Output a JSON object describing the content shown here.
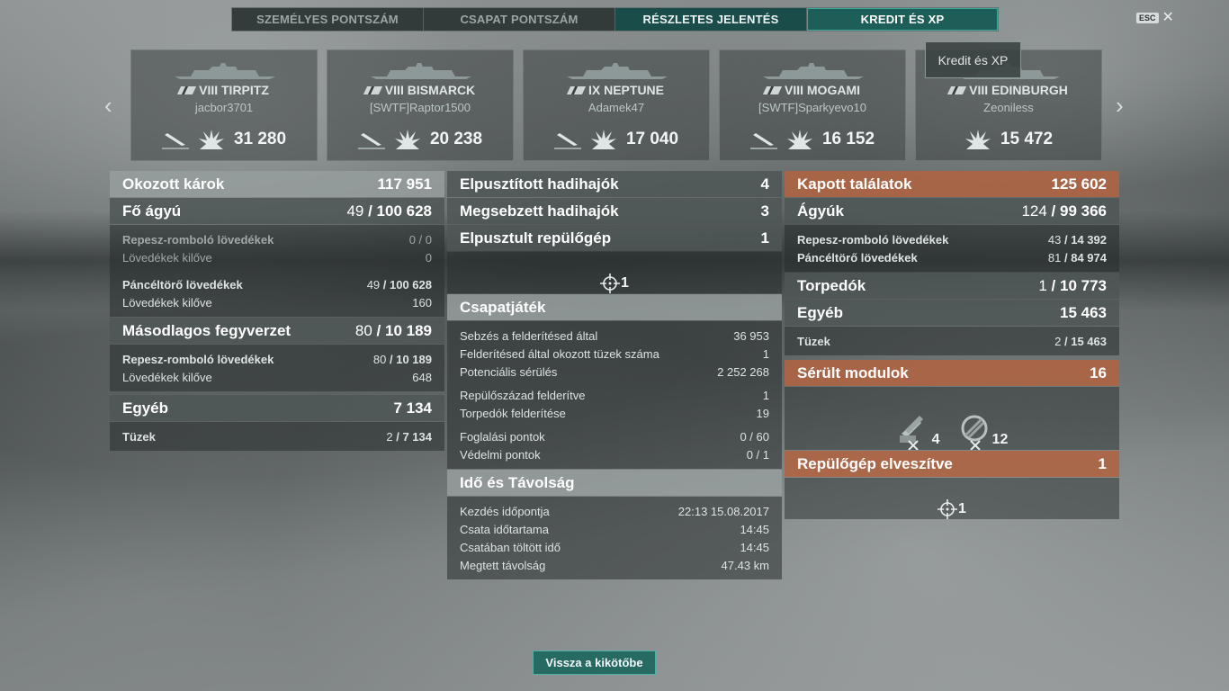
{
  "tabs": [
    {
      "label": "SZEMÉLYES PONTSZÁM"
    },
    {
      "label": "CSAPAT PONTSZÁM"
    },
    {
      "label": "RÉSZLETES JELENTÉS"
    },
    {
      "label": "KREDIT ÉS XP"
    }
  ],
  "esc": {
    "key": "ESC",
    "close": "✕"
  },
  "tooltip": "Kredit és XP",
  "ships": [
    {
      "name": "VIII TIRPITZ",
      "player": "jacbor3701",
      "damage": "31 280"
    },
    {
      "name": "VIII BISMARCK",
      "player": "[SWTF]Raptor1500",
      "damage": "20 238"
    },
    {
      "name": "IX NEPTUNE",
      "player": "Adamek47",
      "damage": "17 040"
    },
    {
      "name": "VIII MOGAMI",
      "player": "[SWTF]Sparkyevo10",
      "damage": "16 152"
    },
    {
      "name": "VIII EDINBURGH",
      "player": "Zeoniless",
      "damage": "15 472"
    }
  ],
  "left": {
    "caused_damage": {
      "label": "Okozott károk",
      "value": "117 951"
    },
    "main_gun": {
      "label": "Fő ágyú",
      "hits": "49",
      "total": "100 628"
    },
    "he_shells": {
      "label": "Repesz-romboló lövedékek",
      "value": "0 / 0"
    },
    "he_fired": {
      "label": "Lövedékek kilőve",
      "value": "0"
    },
    "ap_shells": {
      "label": "Páncéltörő lövedékek",
      "hits": "49",
      "total": "100 628"
    },
    "ap_fired": {
      "label": "Lövedékek kilőve",
      "value": "160"
    },
    "secondary": {
      "label": "Másodlagos fegyverzet",
      "hits": "80",
      "total": "10 189"
    },
    "sec_he": {
      "label": "Repesz-romboló lövedékek",
      "hits": "80",
      "total": "10 189"
    },
    "sec_fired": {
      "label": "Lövedékek kilőve",
      "value": "648"
    },
    "other": {
      "label": "Egyéb",
      "value": "7 134"
    },
    "fires": {
      "label": "Tüzek",
      "hits": "2",
      "total": "7 134"
    }
  },
  "middle": {
    "destroyed_ships": {
      "label": "Elpusztított hadihajók",
      "value": "4"
    },
    "damaged_ships": {
      "label": "Megsebzett hadihajók",
      "value": "3"
    },
    "destroyed_planes": {
      "label": "Elpusztult repülőgép",
      "value": "1"
    },
    "planes_count": "1",
    "teamplay": {
      "title": "Csapatjáték",
      "rows": [
        {
          "label": "Sebzés a felderítésed által",
          "value": "36 953"
        },
        {
          "label": "Felderítésed által okozott tüzek száma",
          "value": "1"
        },
        {
          "label": "Potenciális sérülés",
          "value": "2 252 268"
        },
        {
          "label": "Repülőszázad felderítve",
          "value": "1"
        },
        {
          "label": "Torpedók felderítése",
          "value": "19"
        },
        {
          "label": "Foglalási pontok",
          "value": "0 / 60"
        },
        {
          "label": "Védelmi pontok",
          "value": "0 / 1"
        }
      ]
    },
    "time": {
      "title": "Idő és Távolság",
      "rows": [
        {
          "label": "Kezdés időpontja",
          "value": "22:13  15.08.2017"
        },
        {
          "label": "Csata időtartama",
          "value": "14:45"
        },
        {
          "label": "Csatában töltött idő",
          "value": "14:45"
        },
        {
          "label": "Megtett távolság",
          "value": "47.43 km"
        }
      ]
    }
  },
  "right": {
    "received": {
      "label": "Kapott találatok",
      "value": "125 602"
    },
    "guns": {
      "label": "Ágyúk",
      "hits": "124",
      "total": "99 366"
    },
    "he": {
      "label": "Repesz-romboló lövedékek",
      "hits": "43",
      "total": "14 392"
    },
    "ap": {
      "label": "Páncéltörő lövedékek",
      "hits": "81",
      "total": "84 974"
    },
    "torpedoes": {
      "label": "Torpedók",
      "hits": "1",
      "total": "10 773"
    },
    "other": {
      "label": "Egyéb",
      "value": "15 463"
    },
    "fires": {
      "label": "Tüzek",
      "hits": "2",
      "total": "15 463"
    },
    "modules": {
      "label": "Sérült modulok",
      "value": "16",
      "guns_count": "4",
      "aa_count": "12"
    },
    "planes_lost": {
      "label": "Repülőgép elveszítve",
      "value": "1"
    },
    "planes_count": "1"
  },
  "back_button": "Vissza a kikötőbe"
}
